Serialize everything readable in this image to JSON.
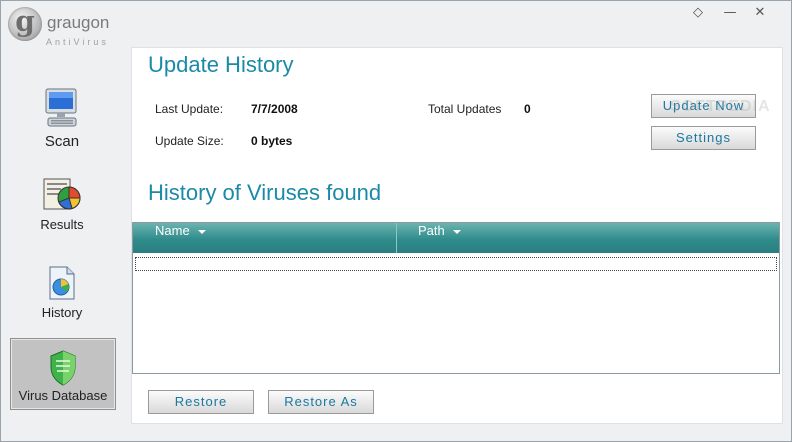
{
  "app": {
    "name": "graugon",
    "subtitle": "AntiVirus",
    "logo_letter": "g"
  },
  "window_controls": {
    "restore_glyph": "◇",
    "minimize_glyph": "—",
    "close_glyph": "✕"
  },
  "sidebar": {
    "items": [
      {
        "label": "Scan",
        "icon": "computer-icon"
      },
      {
        "label": "Results",
        "icon": "results-chart-icon"
      },
      {
        "label": "History",
        "icon": "history-document-icon"
      },
      {
        "label": "Virus Database",
        "icon": "shield-icon",
        "active": true
      }
    ]
  },
  "update_history": {
    "title": "Update History",
    "last_update_label": "Last Update:",
    "last_update_value": "7/7/2008",
    "update_size_label": "Update Size:",
    "update_size_value": "0 bytes",
    "total_updates_label": "Total Updates",
    "total_updates_value": "0",
    "update_now_label": "Update Now",
    "settings_label": "Settings"
  },
  "viruses": {
    "title": "History of Viruses found",
    "columns": [
      "Name",
      "Path"
    ],
    "rows": []
  },
  "footer": {
    "restore_label": "Restore",
    "restore_as_label": "Restore As"
  },
  "watermark": "SOFTPEDIA",
  "colors": {
    "accent": "#1b8aa8",
    "header_teal": "#2f8c8c"
  }
}
